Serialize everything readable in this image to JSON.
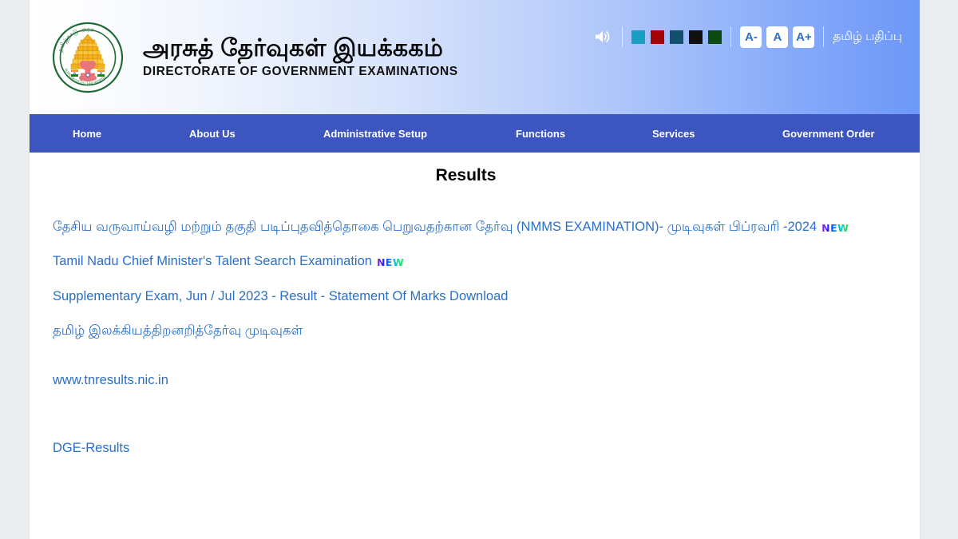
{
  "header": {
    "emblem_name": "tamil-nadu-government-emblem",
    "title_tamil": "அரசுத் தேர்வுகள் இயக்ககம்",
    "title_english": "DIRECTORATE OF GOVERNMENT EXAMINATIONS"
  },
  "accessibility": {
    "speaker_icon": "speaker-icon",
    "swatches": [
      {
        "name": "theme-swatch-cyan",
        "color": "#1a9fc4"
      },
      {
        "name": "theme-swatch-red",
        "color": "#a30306"
      },
      {
        "name": "theme-swatch-teal",
        "color": "#12516b"
      },
      {
        "name": "theme-swatch-black",
        "color": "#101010"
      },
      {
        "name": "theme-swatch-green",
        "color": "#0b4a10"
      }
    ],
    "font_buttons": [
      {
        "name": "font-decrease-button",
        "label": "A-"
      },
      {
        "name": "font-normal-button",
        "label": "A"
      },
      {
        "name": "font-increase-button",
        "label": "A+"
      }
    ],
    "language_link": "தமிழ் பதிப்பு",
    "accent_blue": "#2a6fc9",
    "nav_blue": "#3c55bf"
  },
  "nav": {
    "items": [
      {
        "name": "nav-home",
        "label": "Home"
      },
      {
        "name": "nav-about-us",
        "label": "About Us"
      },
      {
        "name": "nav-administrative-setup",
        "label": "Administrative Setup"
      },
      {
        "name": "nav-functions",
        "label": "Functions"
      },
      {
        "name": "nav-services",
        "label": "Services"
      },
      {
        "name": "nav-government-order",
        "label": "Government Order"
      }
    ]
  },
  "main": {
    "title": "Results",
    "links": [
      {
        "name": "result-link-nmms",
        "text": "தேசிய வருவாய்வழி மற்றும் தகுதி படிப்புதவித்தொகை பெறுவதற்கான தேர்வு (NMMS EXAMINATION)- முடிவுகள் பிப்ரவரி -2024",
        "badge": "NEW"
      },
      {
        "name": "result-link-cm-talent-search",
        "text": "Tamil Nadu Chief Minister's Talent Search Examination",
        "badge": "NEW"
      },
      {
        "name": "result-link-supplementary-exam",
        "text": "Supplementary Exam, Jun / Jul 2023 - Result - Statement Of Marks Download",
        "badge": ""
      },
      {
        "name": "result-link-tamil-literature",
        "text": "தமிழ் இலக்கியத்திறனறித்தேர்வு முடிவுகள்",
        "badge": ""
      },
      {
        "name": "result-link-tnresults",
        "text": "www.tnresults.nic.in",
        "badge": ""
      },
      {
        "name": "result-link-dge-results",
        "text": "DGE-Results",
        "badge": ""
      }
    ]
  }
}
